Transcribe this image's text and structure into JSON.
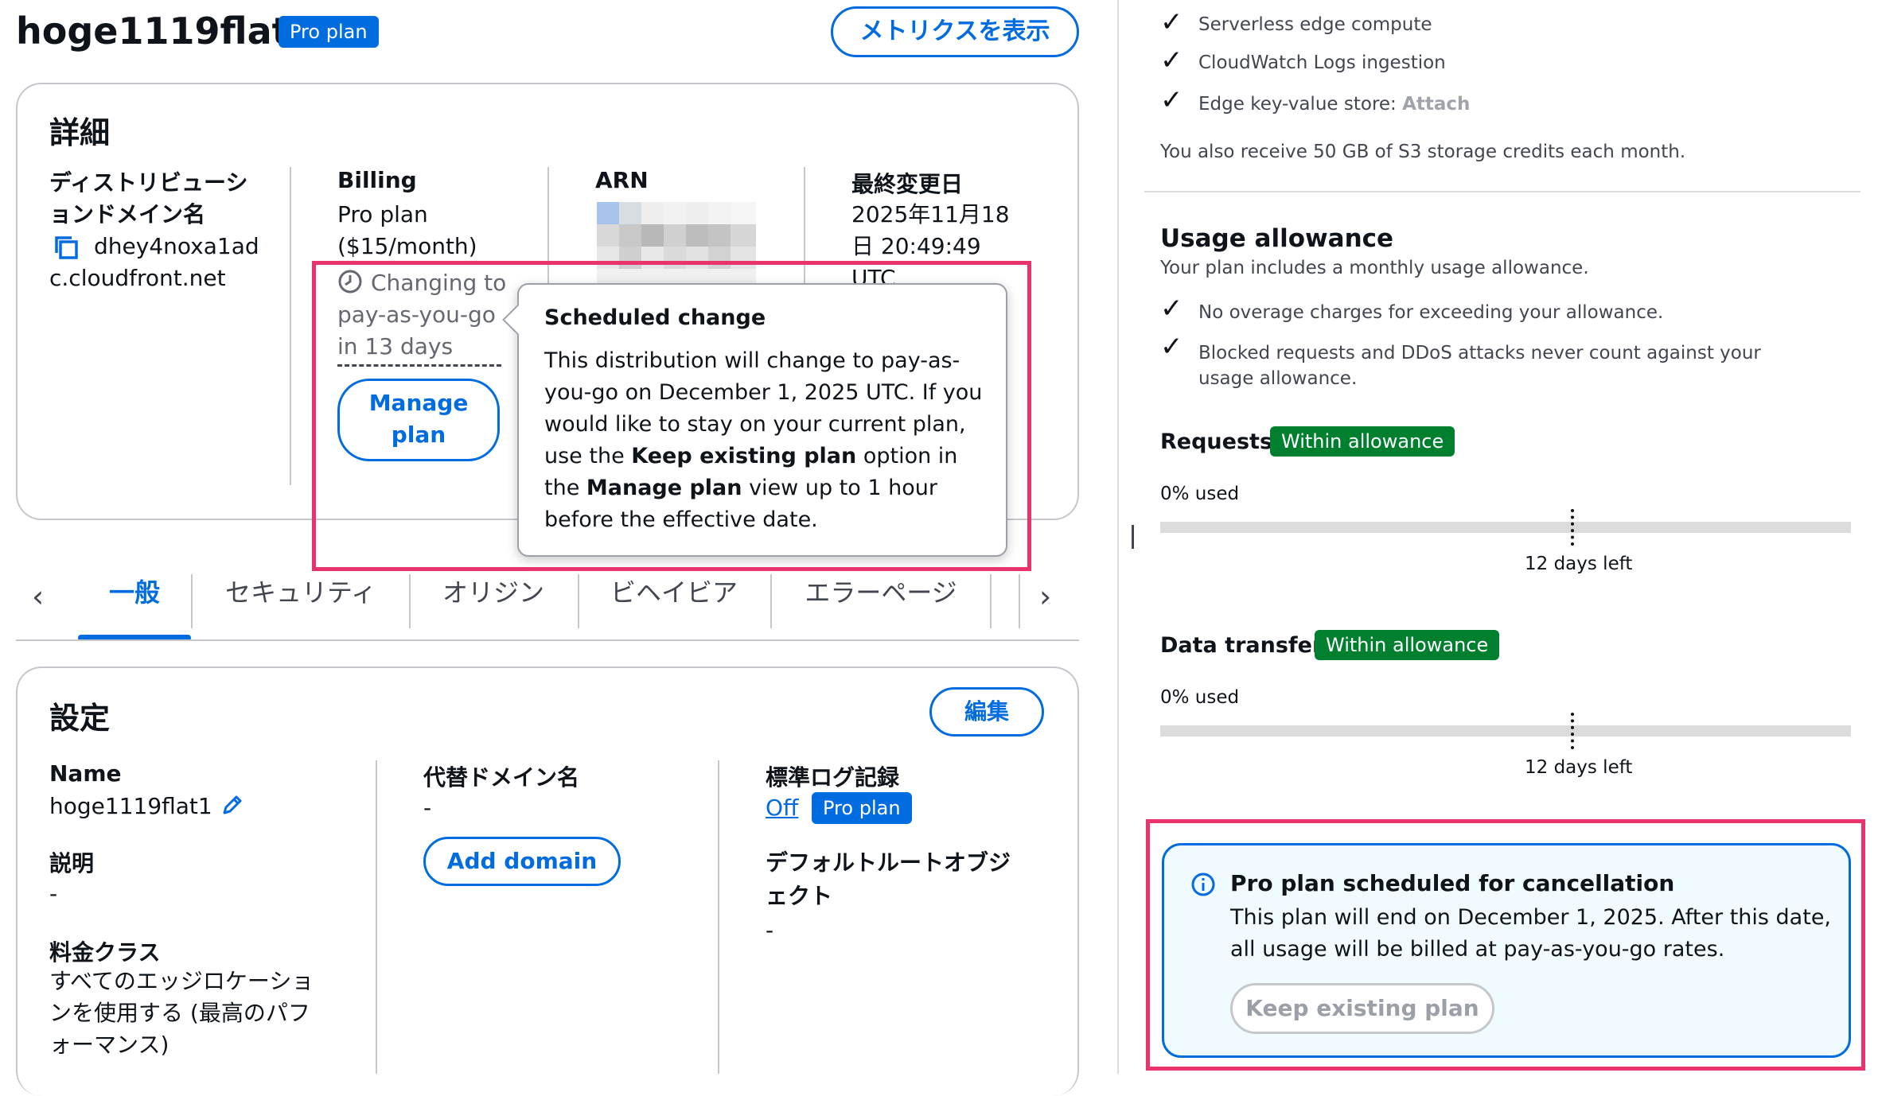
{
  "header": {
    "title": "hoge1119flat1",
    "plan_badge": "Pro plan",
    "metrics_button": "メトリクスを表示"
  },
  "details": {
    "heading": "詳細",
    "domain_label": "ディストリビューションドメイン名",
    "domain_value_1": "dhey4noxa1ad",
    "domain_value_2": "c.cloudfront.net",
    "billing_label": "Billing",
    "billing_plan": "Pro plan",
    "billing_price": "($15/month)",
    "changing_line1": "Changing to",
    "changing_line2": "pay-as-you-go",
    "changing_line3": "in 13 days",
    "manage_plan": "Manage plan",
    "arn_label": "ARN",
    "modified_label": "最終変更日",
    "modified_line1": "2025年11月18",
    "modified_line2": "日 20:49:49",
    "modified_line3": "UTC"
  },
  "popover": {
    "title": "Scheduled change",
    "body_1": "This distribution will change to pay-as-you-go on December 1, 2025 UTC. If you would like to stay on your current plan, use the ",
    "body_bold_1": "Keep existing plan",
    "body_2": " option in the ",
    "body_bold_2": "Manage plan",
    "body_3": " view up to 1 hour before the effective date."
  },
  "tabs": [
    "一般",
    "セキュリティ",
    "オリジン",
    "ビヘイビア",
    "エラーページ"
  ],
  "settings": {
    "heading": "設定",
    "edit_button": "編集",
    "name_label": "Name",
    "name_value": "hoge1119flat1",
    "description_label": "説明",
    "description_value": "-",
    "price_class_label": "料金クラス",
    "price_class_value": "すべてのエッジロケーションを使用する (最高のパフォーマンス)",
    "alt_domain_label": "代替ドメイン名",
    "alt_domain_value": "-",
    "add_domain": "Add domain",
    "std_log_label": "標準ログ記録",
    "std_log_value": "Off",
    "std_log_badge": "Pro plan",
    "default_root_label": "デフォルトルートオブジェクト",
    "default_root_value": "-"
  },
  "right": {
    "features": [
      "Serverless edge compute",
      "CloudWatch Logs ingestion"
    ],
    "kv_store_label": "Edge key-value store: ",
    "kv_store_link": "Attach",
    "s3_note": "You also receive 50 GB of S3 storage credits each month.",
    "usage_heading": "Usage allowance",
    "usage_sub": "Your plan includes a monthly usage allowance.",
    "usage_points": [
      "No overage charges for exceeding your allowance.",
      "Blocked requests and DDoS attacks never count against your usage allowance."
    ],
    "requests_label": "Requests",
    "requests_badge": "Within allowance",
    "requests_used": "0% used",
    "requests_days": "12 days left",
    "transfer_label": "Data transfer",
    "transfer_badge": "Within allowance",
    "transfer_used": "0% used",
    "transfer_days": "12 days left",
    "alert_title": "Pro plan scheduled for cancellation",
    "alert_body": "This plan will end on December 1, 2025. After this date, all usage will be billed at pay-as-you-go rates.",
    "keep_button": "Keep existing plan"
  },
  "colors": {
    "accent": "#006ce0",
    "highlight": "#e8336d",
    "success": "#00802f",
    "info_bg": "#f0fbff"
  }
}
